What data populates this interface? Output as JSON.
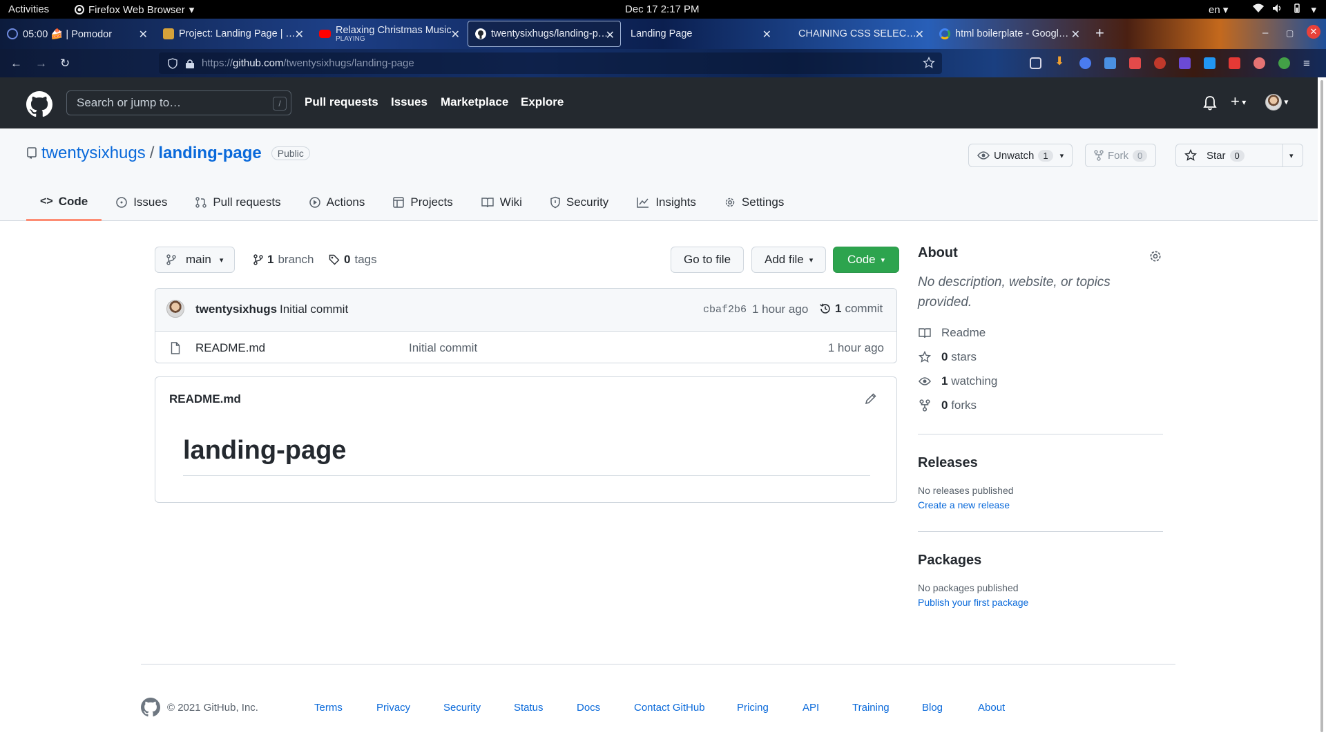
{
  "os": {
    "activities": "Activities",
    "app_name": "Firefox Web Browser",
    "clock": "Dec 17  2:17 PM",
    "lang": "en"
  },
  "tabs": [
    {
      "title": "05:00 🍰 | Pomodor",
      "favicon": "pomodoro-icon",
      "color": "#5b7bd6"
    },
    {
      "title": "Project: Landing Page | The Odin Project",
      "favicon": "odin-icon",
      "color": "#d6a23a"
    },
    {
      "title": "Relaxing Christmas Music",
      "sub": "PLAYING",
      "favicon": "youtube-icon",
      "color": "#ff0000"
    },
    {
      "title": "twentysixhugs/landing-page",
      "favicon": "github-icon",
      "color": "#ffffff",
      "active": true
    },
    {
      "title": "Landing Page",
      "favicon": "none",
      "color": ""
    },
    {
      "title": "CHAINING CSS SELECTORS",
      "favicon": "none",
      "color": ""
    },
    {
      "title": "html boilerplate - Google Search",
      "favicon": "google-icon",
      "color": "#4285f4"
    }
  ],
  "url": {
    "prefix": "https://",
    "host": "github.com",
    "path": "/twentysixhugs/landing-page"
  },
  "github": {
    "search_placeholder": "Search or jump to…",
    "slash_hint": "/",
    "nav": [
      "Pull requests",
      "Issues",
      "Marketplace",
      "Explore"
    ]
  },
  "repo": {
    "owner": "twentysixhugs",
    "name": "landing-page",
    "visibility": "Public",
    "unwatch_label": "Unwatch",
    "watch_count": "1",
    "fork_label": "Fork",
    "fork_count": "0",
    "star_label": "Star",
    "star_count": "0",
    "tabs": [
      "Code",
      "Issues",
      "Pull requests",
      "Actions",
      "Projects",
      "Wiki",
      "Security",
      "Insights",
      "Settings"
    ]
  },
  "toolbar": {
    "branch": "main",
    "branch_count": "1",
    "branch_label": "branch",
    "tag_count": "0",
    "tag_label": "tags",
    "go_to_file": "Go to file",
    "add_file": "Add file",
    "code": "Code"
  },
  "commit": {
    "author": "twentysixhugs",
    "message": "Initial commit",
    "sha": "cbaf2b6",
    "time": "1 hour ago",
    "count": "1",
    "count_label": "commit"
  },
  "files": [
    {
      "name": "README.md",
      "message": "Initial commit",
      "time": "1 hour ago"
    }
  ],
  "readme": {
    "filename": "README.md",
    "heading": "landing-page"
  },
  "about": {
    "title": "About",
    "description": "No description, website, or topics provided.",
    "readme": "Readme",
    "stars_count": "0",
    "stars_label": "stars",
    "watching_count": "1",
    "watching_label": "watching",
    "forks_count": "0",
    "forks_label": "forks"
  },
  "releases": {
    "title": "Releases",
    "empty": "No releases published",
    "link": "Create a new release"
  },
  "packages": {
    "title": "Packages",
    "empty": "No packages published",
    "link": "Publish your first package"
  },
  "footer": {
    "copyright": "© 2021 GitHub, Inc.",
    "links": [
      "Terms",
      "Privacy",
      "Security",
      "Status",
      "Docs",
      "Contact GitHub",
      "Pricing",
      "API",
      "Training",
      "Blog",
      "About"
    ]
  }
}
